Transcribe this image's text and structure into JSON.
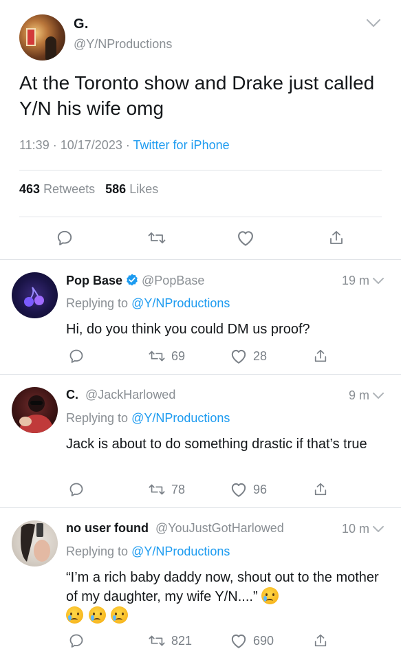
{
  "main_tweet": {
    "author_name": "G.",
    "author_handle": "@Y/NProductions",
    "text": "At the Toronto show and Drake just called Y/N his wife omg",
    "time": "11:39",
    "date": "10/17/2023",
    "separator": "·",
    "source": "Twitter for iPhone",
    "retweets_count": "463",
    "retweets_label": "Retweets",
    "likes_count": "586",
    "likes_label": "Likes"
  },
  "replies": [
    {
      "name": "Pop Base",
      "handle": "@PopBase",
      "verified": true,
      "time": "19 m",
      "replying_label": "Replying to",
      "replying_to": "@Y/NProductions",
      "text": "Hi, do you think you could DM us proof?",
      "retweets": "69",
      "likes": "28"
    },
    {
      "name": "C.",
      "handle": "@JackHarlowed",
      "verified": false,
      "time": "9 m",
      "replying_label": "Replying to",
      "replying_to": "@Y/NProductions",
      "text": "Jack is about to do something drastic if that’s true",
      "retweets": "78",
      "likes": "96"
    },
    {
      "name": "no user found",
      "handle": "@YouJustGotHarlowed",
      "verified": false,
      "time": "10 m",
      "replying_label": "Replying to",
      "replying_to": "@Y/NProductions",
      "text": "“I’m a rich baby daddy now, shout out to the mother of my daughter, my wife Y/N....”",
      "emoji": "crying-face-emoji",
      "retweets": "821",
      "likes": "690"
    }
  ],
  "colors": {
    "link": "#1d9bf0",
    "muted": "#8a8f94",
    "text": "#14171a",
    "divider": "#e1e4e8"
  },
  "icons": [
    "chevron-down-icon",
    "reply-icon",
    "retweet-icon",
    "like-icon",
    "share-icon",
    "verified-badge-icon"
  ]
}
